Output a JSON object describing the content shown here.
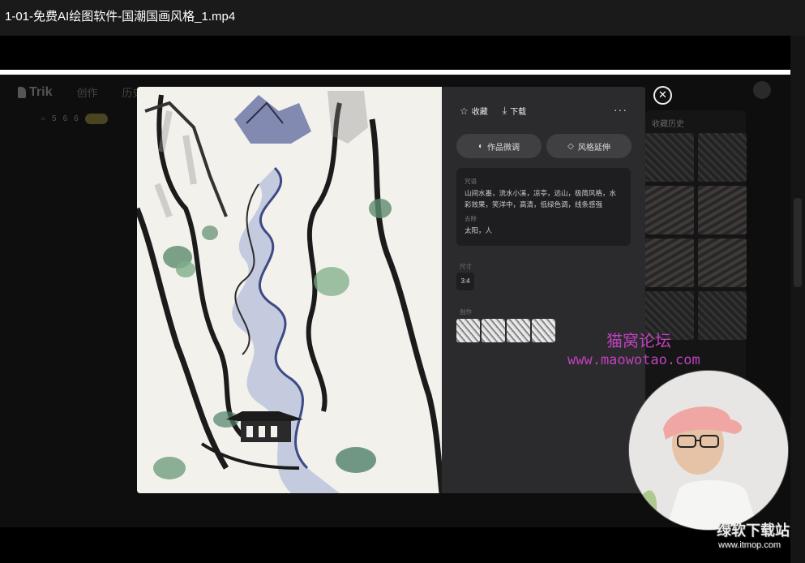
{
  "window": {
    "title": "1-01-免费AI绘图软件-国潮国画风格_1.mp4"
  },
  "app": {
    "logo": "Trik",
    "nav": [
      "创作",
      "历史"
    ],
    "sub_items": [
      "5",
      "6",
      "6"
    ],
    "sub_badge": "",
    "history_title": "收藏历史"
  },
  "modal": {
    "close_icon": "close-icon",
    "favorite_label": "收藏",
    "download_label": "下载",
    "more_label": "···",
    "fine_tune_label": "作品微调",
    "style_transfer_label": "风格延伸",
    "prompt_label": "咒语",
    "prompt_text": "山间水墨，流水小溪，凉亭，远山，极简风格，水彩效果，笑洋中，高清，低绿色调，线条感强",
    "negative_label": "去除",
    "negative_text": "太阳，人",
    "size_label": "尺寸",
    "size_value": "3:4",
    "works_label": "创作"
  },
  "watermarks": {
    "forum_name": "猫窝论坛",
    "forum_url": "www.maowotao.com",
    "site_name": "绿软下载站",
    "site_url": "www.itmop.com"
  },
  "colors": {
    "watermark": "#c040c0",
    "panel": "#2b2b2d",
    "paper": "#f3f1ec"
  }
}
